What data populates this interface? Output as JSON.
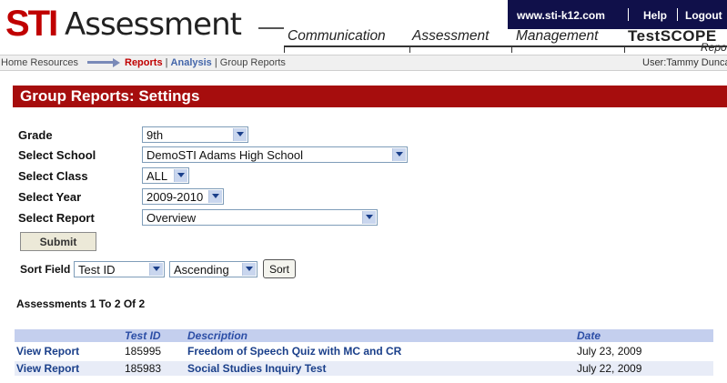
{
  "header": {
    "logo_sti": "STI",
    "logo_assessment": "Assessment",
    "top_links": [
      "www.sti-k12.com",
      "Help",
      "Logout"
    ],
    "nav": [
      "Communication",
      "Assessment",
      "Management"
    ],
    "testscope": "TestSCOPE",
    "testscope_sub": "Report"
  },
  "breadcrumb": {
    "home": "Home",
    "resources": "Resources",
    "reports": "Reports",
    "sep1": "|",
    "analysis": "Analysis",
    "sep2": "|",
    "group_reports": "Group Reports",
    "user": "User:Tammy Dunca"
  },
  "page_title": "Group Reports: Settings",
  "form": {
    "grade": {
      "label": "Grade",
      "value": "9th"
    },
    "school": {
      "label": "Select School",
      "value": "DemoSTI Adams High School"
    },
    "class": {
      "label": "Select Class",
      "value": "ALL"
    },
    "year": {
      "label": "Select Year",
      "value": "2009-2010"
    },
    "report": {
      "label": "Select Report",
      "value": "Overview"
    },
    "submit_label": "Submit",
    "sort_field_label": "Sort Field",
    "sort_field_value": "Test ID",
    "sort_order_value": "Ascending",
    "sort_button_label": "Sort"
  },
  "results": {
    "count_text": "Assessments 1 To 2 Of 2",
    "columns": [
      "Test ID",
      "Description",
      "Date"
    ],
    "rows": [
      {
        "action": "View Report",
        "test_id": "185995",
        "description": "Freedom of Speech Quiz with MC and CR",
        "date": "July 23, 2009"
      },
      {
        "action": "View Report",
        "test_id": "185983",
        "description": "Social Studies Inquiry Test",
        "date": "July 22, 2009"
      }
    ]
  },
  "colors": {
    "brand_red": "#c00000",
    "title_bar": "#a60d0d",
    "top_bar_navy": "#10104a",
    "grid_header": "#c4cfee",
    "link_blue": "#1a3f8a"
  }
}
